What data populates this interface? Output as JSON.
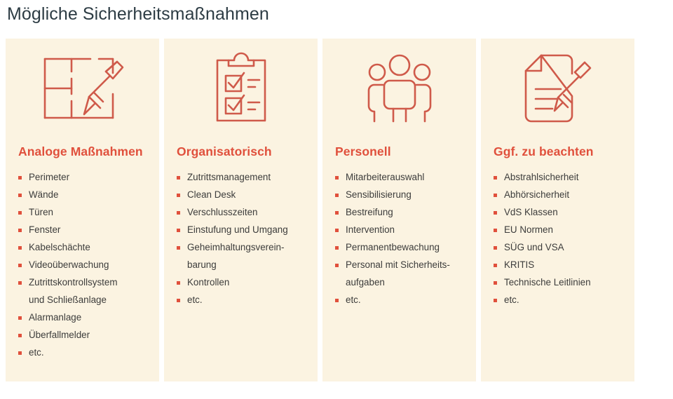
{
  "page": {
    "title": "Mögliche Sicherheitsmaßnahmen",
    "colors": {
      "title_text": "#2d3c44",
      "card_background": "#fbf3e1",
      "accent_red": "#e0503c",
      "icon_stroke": "#cf5a4a",
      "list_text": "#3c3c3b",
      "page_background": "#ffffff"
    }
  },
  "cards": [
    {
      "icon": "floorplan-pencil-icon",
      "heading": "Analoge Maßnahmen",
      "items": [
        "Perimeter",
        "Wände",
        "Türen",
        "Fenster",
        "Kabelschächte",
        "Videoüberwachung",
        "Zutrittskontrollsystem",
        "Alarmanlage",
        "Überfallmelder",
        "etc."
      ],
      "item_continuations": {
        "6": "und Schließanlage"
      }
    },
    {
      "icon": "clipboard-checklist-icon",
      "heading": "Organisatorisch",
      "items": [
        "Zutrittsmanagement",
        "Clean Desk",
        "Verschlusszeiten",
        "Einstufung und Umgang",
        "Geheimhaltungsverein-",
        "Kontrollen",
        "etc."
      ],
      "item_continuations": {
        "4": "barung"
      }
    },
    {
      "icon": "three-people-icon",
      "heading": "Personell",
      "items": [
        "Mitarbeiterauswahl",
        "Sensibilisierung",
        "Bestreifung",
        "Intervention",
        "Permanentbewachung",
        "Personal mit Sicherheits-",
        "etc."
      ],
      "item_continuations": {
        "5": "aufgaben"
      }
    },
    {
      "icon": "document-pencil-icon",
      "heading": "Ggf. zu beachten",
      "items": [
        "Abstrahlsicherheit",
        "Abhörsicherheit",
        "VdS Klassen",
        "EU Normen",
        "SÜG und VSA",
        "KRITIS",
        "Technische Leitlinien",
        "etc."
      ],
      "item_continuations": {}
    }
  ]
}
